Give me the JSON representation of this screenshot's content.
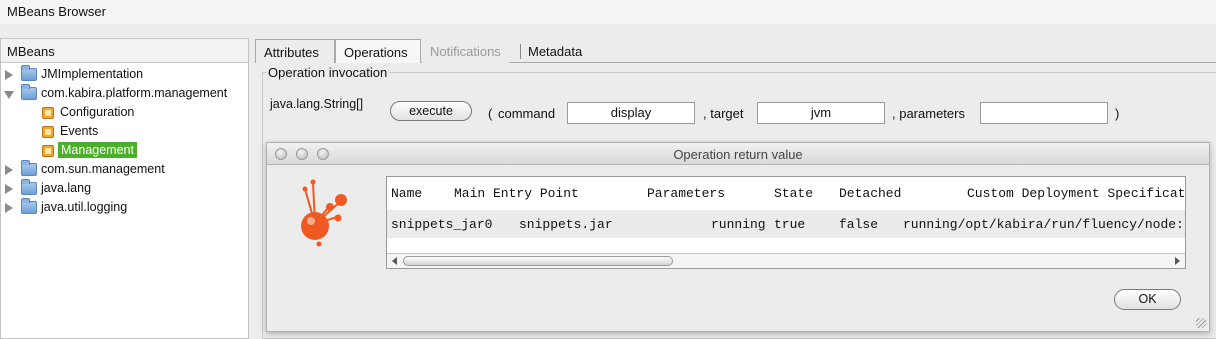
{
  "window": {
    "title": "MBeans Browser"
  },
  "sidebar": {
    "header": "MBeans",
    "items": [
      {
        "label": "JMImplementation"
      },
      {
        "label": "com.kabira.platform.management"
      },
      {
        "label": "Configuration"
      },
      {
        "label": "Events"
      },
      {
        "label": "Management"
      },
      {
        "label": "com.sun.management"
      },
      {
        "label": "java.lang"
      },
      {
        "label": "java.util.logging"
      }
    ],
    "selected_color": "#4caf2a"
  },
  "tabs": [
    {
      "label": "Attributes"
    },
    {
      "label": "Operations"
    },
    {
      "label": "Notifications"
    },
    {
      "label": "Metadata"
    }
  ],
  "operation": {
    "group_title": "Operation invocation",
    "return_type": "java.lang.String[]",
    "execute_label": "execute",
    "open_paren": "(",
    "command_label": "command",
    "command_value": "display",
    "target_sep": ", target",
    "target_value": "jvm",
    "parameters_sep": ", parameters",
    "parameters_value": "",
    "close_paren": ")"
  },
  "dialog": {
    "title": "Operation return value",
    "headers": [
      "Name",
      "Main Entry Point",
      "Parameters",
      "State",
      "Detached",
      "Custom Deployment Specificat"
    ],
    "row": [
      "snippets_jar0",
      "snippets.jar",
      "running",
      "true",
      "false",
      "running/opt/kabira/run/fluency/node:"
    ],
    "ok_label": "OK",
    "logo_color": "#f05a22"
  }
}
